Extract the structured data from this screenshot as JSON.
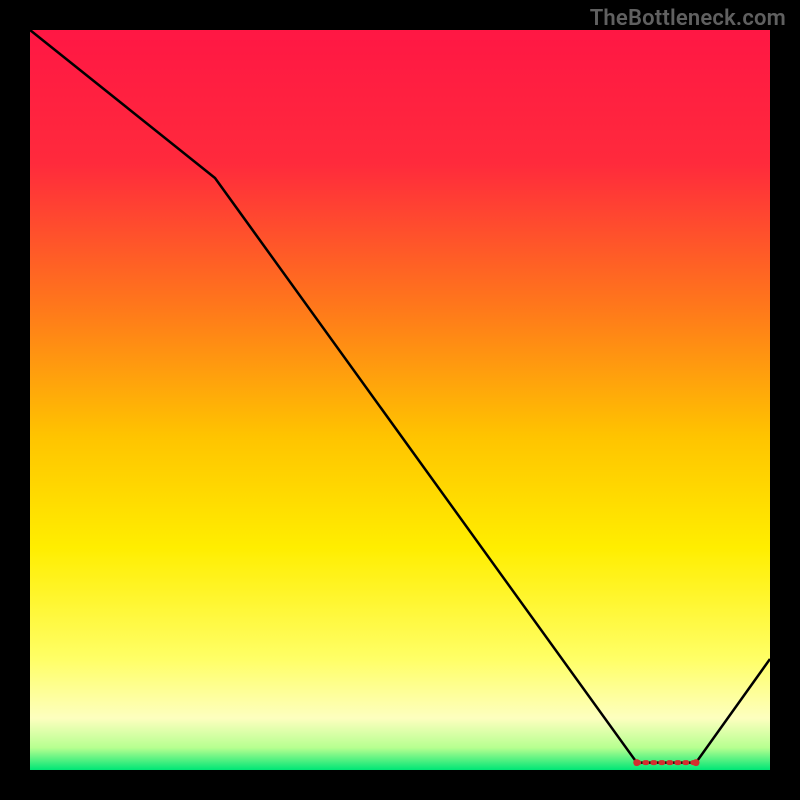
{
  "watermark": "TheBottleneck.com",
  "chart_data": {
    "type": "line",
    "title": "",
    "xlabel": "",
    "ylabel": "",
    "xlim": [
      0,
      100
    ],
    "ylim": [
      0,
      100
    ],
    "series": [
      {
        "name": "curve",
        "x": [
          0,
          25,
          82,
          90,
          100
        ],
        "values": [
          100,
          80,
          1,
          1,
          15
        ]
      }
    ],
    "optimal_band": {
      "x_start": 82,
      "x_end": 90,
      "y": 1
    },
    "gradient_stops": [
      {
        "offset": 0.0,
        "color": "#ff1744"
      },
      {
        "offset": 0.18,
        "color": "#ff2a3c"
      },
      {
        "offset": 0.38,
        "color": "#ff7a1a"
      },
      {
        "offset": 0.55,
        "color": "#ffc400"
      },
      {
        "offset": 0.7,
        "color": "#ffee00"
      },
      {
        "offset": 0.85,
        "color": "#ffff66"
      },
      {
        "offset": 0.93,
        "color": "#fdffbf"
      },
      {
        "offset": 0.97,
        "color": "#b6ff90"
      },
      {
        "offset": 1.0,
        "color": "#00e676"
      }
    ]
  }
}
